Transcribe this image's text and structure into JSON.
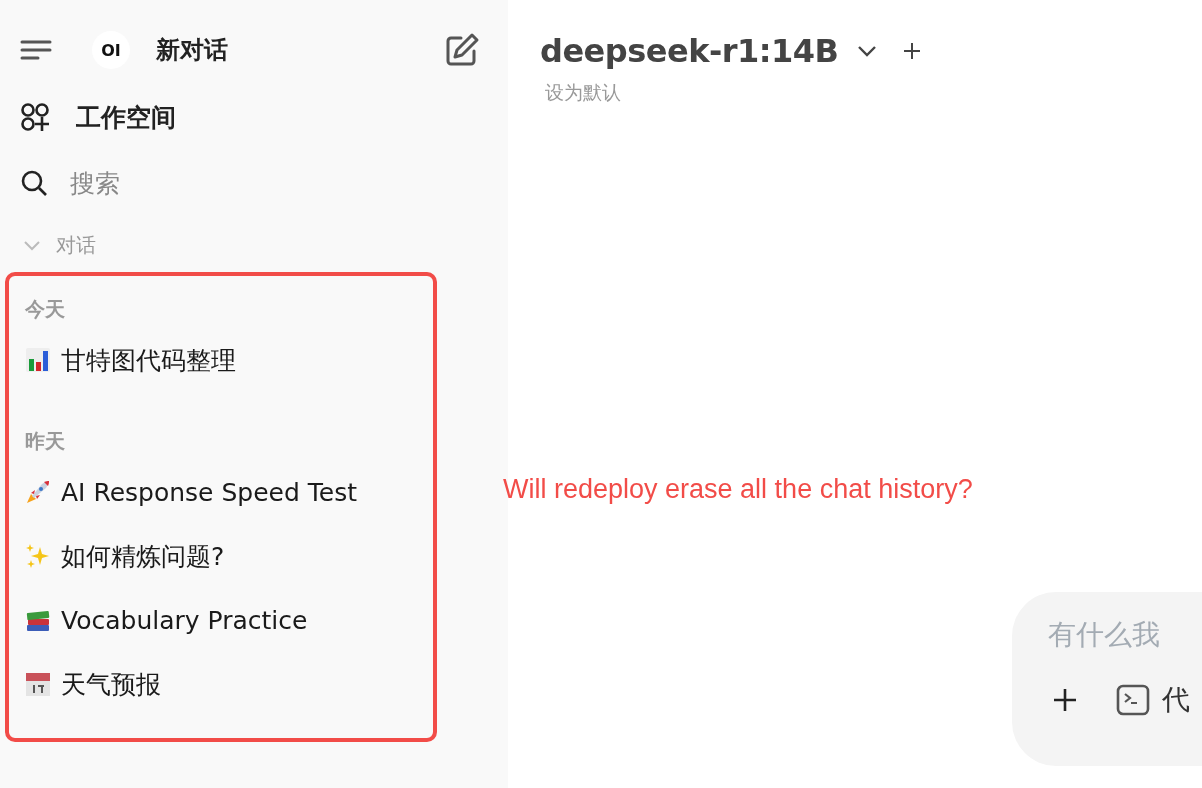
{
  "sidebar": {
    "logo": "OI",
    "new_chat": "新对话",
    "nav": [
      {
        "kind": "workspace",
        "label": "工作空间"
      },
      {
        "kind": "search",
        "label": "搜索"
      }
    ],
    "section": {
      "label": "对话",
      "expanded": true
    },
    "groups": [
      {
        "label": "今天",
        "chats": [
          {
            "title": "甘特图代码整理"
          }
        ]
      },
      {
        "label": "昨天",
        "chats": [
          {
            "title": "AI Response Speed Test"
          },
          {
            "title": "如何精炼问题?"
          },
          {
            "title": "Vocabulary Practice"
          },
          {
            "title": "天气预报"
          }
        ]
      }
    ]
  },
  "main": {
    "model": "deepseek-r1:14B",
    "set_default": "设为默认",
    "input": {
      "placeholder": "有什么我",
      "tool": "代"
    }
  },
  "annotation": "Will redeploy erase all the chat history?"
}
